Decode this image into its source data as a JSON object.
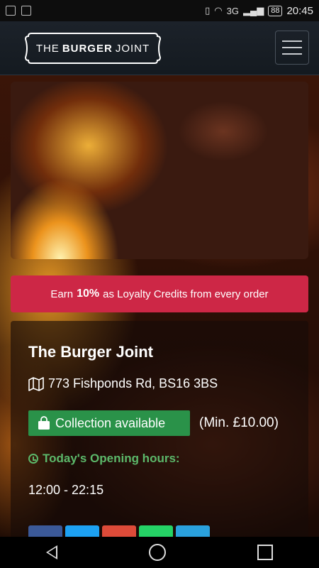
{
  "status_bar": {
    "network": "3G",
    "battery": "88",
    "time": "20:45"
  },
  "header": {
    "logo": {
      "prefix": "THE",
      "bold": "BURGER",
      "suffix": "JOINT"
    }
  },
  "loyalty": {
    "prefix": "Earn",
    "percent": "10%",
    "suffix": "as Loyalty Credits from every order"
  },
  "restaurant": {
    "name": "The Burger Joint",
    "address": "773 Fishponds Rd, BS16 3BS",
    "collection_label": "Collection available",
    "min_order": "(Min. £10.00)",
    "hours_title": "Today's Opening hours:",
    "hours": "12:00 - 22:15"
  },
  "colors": {
    "loyalty_bg": "#cd2746",
    "collection_bg": "#2a9249",
    "hours_title": "#5cb86a"
  },
  "share_buttons": [
    "facebook",
    "twitter",
    "google-plus",
    "whatsapp",
    "telegram"
  ]
}
